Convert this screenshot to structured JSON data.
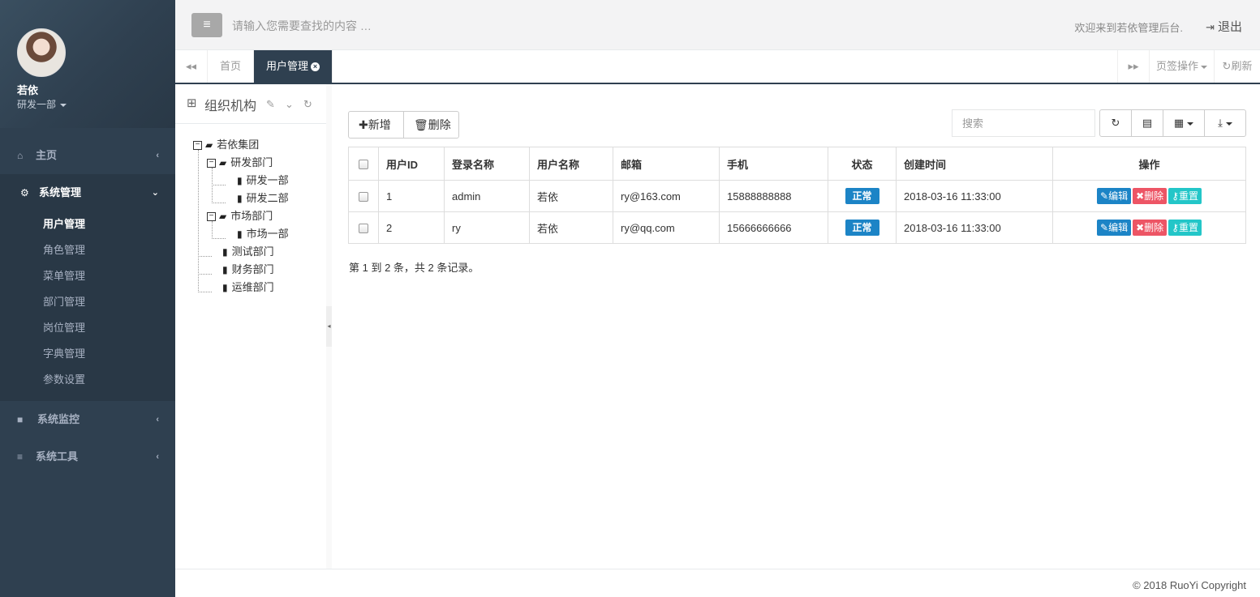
{
  "profile": {
    "name": "若依",
    "dept": "研发一部"
  },
  "nav": {
    "home": {
      "icon": "home-icon",
      "label": "主页",
      "arrow": "‹"
    },
    "system": {
      "icon": "gear-icon",
      "label": "系统管理",
      "arrow": "⌄"
    },
    "submenu": [
      "用户管理",
      "角色管理",
      "菜单管理",
      "部门管理",
      "岗位管理",
      "字典管理",
      "参数设置"
    ],
    "monitor": {
      "icon": "video-icon",
      "label": "系统监控",
      "arrow": "‹"
    },
    "tools": {
      "icon": "bars-icon",
      "label": "系统工具",
      "arrow": "‹"
    }
  },
  "topbar": {
    "search_placeholder": "请输入您需要查找的内容 …",
    "welcome": "欢迎来到若依管理后台.",
    "logout": "退出"
  },
  "tabs": {
    "home": "首页",
    "active": "用户管理",
    "ops": "页签操作",
    "refresh": "刷新"
  },
  "tree": {
    "title": "组织机构",
    "nodes": {
      "root": "若依集团",
      "rd": "研发部门",
      "rd1": "研发一部",
      "rd2": "研发二部",
      "market": "市场部门",
      "market1": "市场一部",
      "test": "测试部门",
      "finance": "财务部门",
      "ops": "运维部门"
    }
  },
  "toolbar": {
    "add": "新增",
    "delete": "删除",
    "search_placeholder": "搜索"
  },
  "table": {
    "headers": [
      "用户ID",
      "登录名称",
      "用户名称",
      "邮箱",
      "手机",
      "状态",
      "创建时间",
      "操作"
    ],
    "rows": [
      {
        "id": "1",
        "login": "admin",
        "name": "若依",
        "email": "ry@163.com",
        "phone": "15888888888",
        "status": "正常",
        "created": "2018-03-16 11:33:00"
      },
      {
        "id": "2",
        "login": "ry",
        "name": "若依",
        "email": "ry@qq.com",
        "phone": "15666666666",
        "status": "正常",
        "created": "2018-03-16 11:33:00"
      }
    ],
    "actions": {
      "edit": "编辑",
      "delete": "删除",
      "reset": "重置"
    }
  },
  "pagination": {
    "info": "第 1 到 2 条，共 2 条记录。"
  },
  "footer": {
    "copyright": "© 2018 RuoYi Copyright"
  },
  "colors": {
    "sidebar": "#2f4050",
    "primary": "#1c84c6",
    "danger": "#ed5565",
    "info": "#23c6c8"
  }
}
